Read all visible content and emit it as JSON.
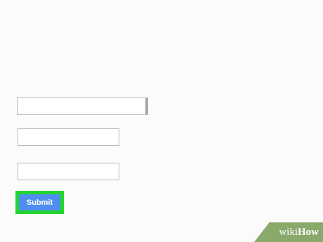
{
  "form": {
    "fields": [
      {
        "value": "",
        "placeholder": ""
      },
      {
        "value": "",
        "placeholder": ""
      },
      {
        "value": "",
        "placeholder": ""
      }
    ],
    "submit_label": "Submit"
  },
  "watermark": {
    "wiki": "wiki",
    "how": "How"
  },
  "colors": {
    "background": "#fcfbfc",
    "highlight": "#22d42f",
    "button": "#4d8ef0",
    "watermark": "#8aaa6b"
  }
}
